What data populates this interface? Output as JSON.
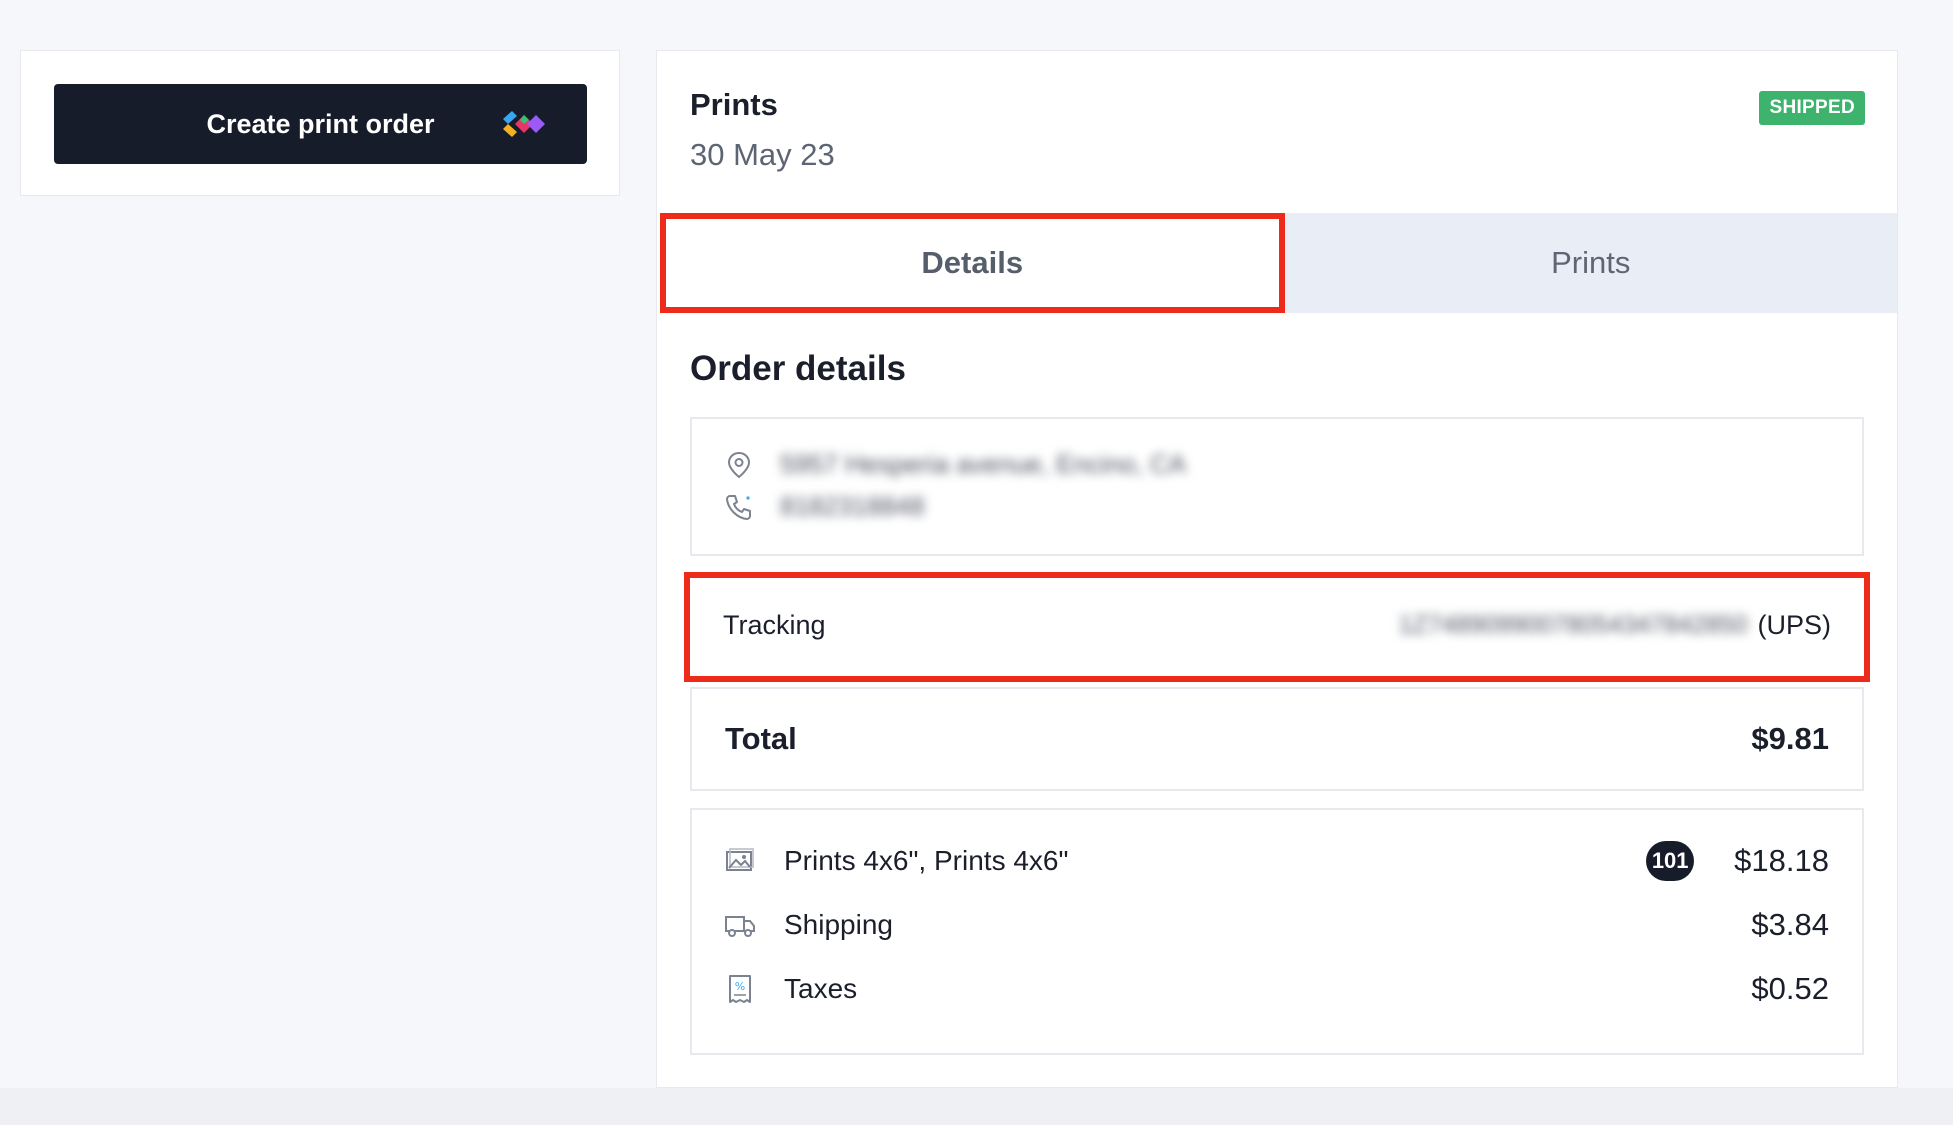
{
  "left": {
    "create_button_label": "Create print order"
  },
  "order": {
    "title": "Prints",
    "date": "30 May 23",
    "status_badge": "SHIPPED",
    "tabs": [
      {
        "label": "Details",
        "active": true
      },
      {
        "label": "Prints",
        "active": false
      }
    ],
    "section_title": "Order details",
    "contact": {
      "address": "5957 Hesperia avenue, Encino, CA",
      "phone": "8182318848",
      "address_icon": "map-pin-icon",
      "phone_icon": "phone-icon"
    },
    "tracking": {
      "label": "Tracking",
      "number": "1Z74890990078054347842850",
      "carrier": "(UPS)"
    },
    "total": {
      "label": "Total",
      "value": "$9.81"
    },
    "items": [
      {
        "icon": "image-icon",
        "label": "Prints 4x6\", Prints 4x6\"",
        "count": "101",
        "price": "$18.18"
      },
      {
        "icon": "truck-icon",
        "label": "Shipping",
        "price": "$3.84"
      },
      {
        "icon": "receipt-icon",
        "label": "Taxes",
        "price": "$0.52"
      }
    ]
  },
  "colors": {
    "accent_dark": "#161c2a",
    "badge_green": "#3db36d",
    "highlight_red": "#ee2a1a",
    "inactive_tab": "#e9edf5"
  }
}
